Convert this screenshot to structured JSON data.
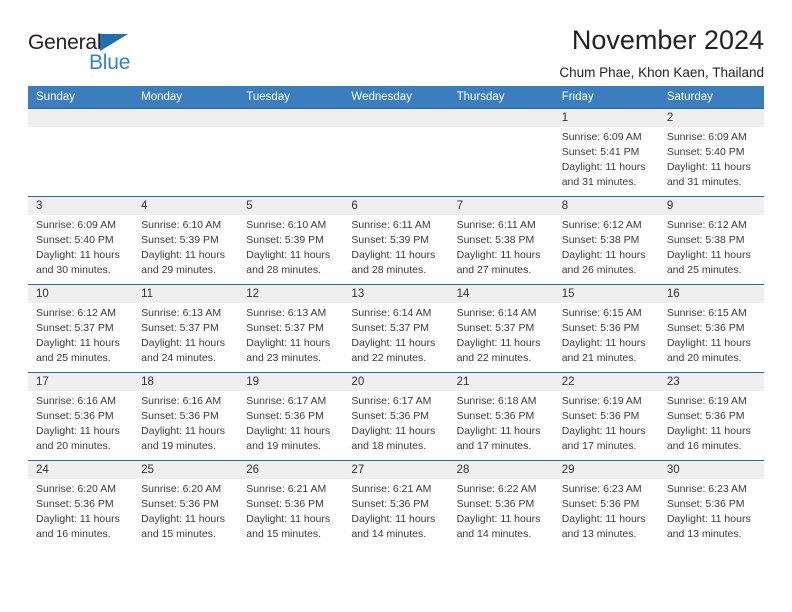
{
  "brand": {
    "name_top": "General",
    "name_bottom": "Blue",
    "triangle_color": "#1f6fb2",
    "blue_text_color": "#2e86d1"
  },
  "header": {
    "title": "November 2024",
    "subtitle": "Chum Phae, Khon Kaen, Thailand"
  },
  "theme": {
    "header_blue": "#3b7ec0",
    "row_divider_blue": "#2b6ca8",
    "daynum_band": "#efefef"
  },
  "weekdays": [
    "Sunday",
    "Monday",
    "Tuesday",
    "Wednesday",
    "Thursday",
    "Friday",
    "Saturday"
  ],
  "weeks": [
    [
      {
        "day": "",
        "sunrise": "",
        "sunset": "",
        "daylight": ""
      },
      {
        "day": "",
        "sunrise": "",
        "sunset": "",
        "daylight": ""
      },
      {
        "day": "",
        "sunrise": "",
        "sunset": "",
        "daylight": ""
      },
      {
        "day": "",
        "sunrise": "",
        "sunset": "",
        "daylight": ""
      },
      {
        "day": "",
        "sunrise": "",
        "sunset": "",
        "daylight": ""
      },
      {
        "day": "1",
        "sunrise": "Sunrise: 6:09 AM",
        "sunset": "Sunset: 5:41 PM",
        "daylight": "Daylight: 11 hours and 31 minutes."
      },
      {
        "day": "2",
        "sunrise": "Sunrise: 6:09 AM",
        "sunset": "Sunset: 5:40 PM",
        "daylight": "Daylight: 11 hours and 31 minutes."
      }
    ],
    [
      {
        "day": "3",
        "sunrise": "Sunrise: 6:09 AM",
        "sunset": "Sunset: 5:40 PM",
        "daylight": "Daylight: 11 hours and 30 minutes."
      },
      {
        "day": "4",
        "sunrise": "Sunrise: 6:10 AM",
        "sunset": "Sunset: 5:39 PM",
        "daylight": "Daylight: 11 hours and 29 minutes."
      },
      {
        "day": "5",
        "sunrise": "Sunrise: 6:10 AM",
        "sunset": "Sunset: 5:39 PM",
        "daylight": "Daylight: 11 hours and 28 minutes."
      },
      {
        "day": "6",
        "sunrise": "Sunrise: 6:11 AM",
        "sunset": "Sunset: 5:39 PM",
        "daylight": "Daylight: 11 hours and 28 minutes."
      },
      {
        "day": "7",
        "sunrise": "Sunrise: 6:11 AM",
        "sunset": "Sunset: 5:38 PM",
        "daylight": "Daylight: 11 hours and 27 minutes."
      },
      {
        "day": "8",
        "sunrise": "Sunrise: 6:12 AM",
        "sunset": "Sunset: 5:38 PM",
        "daylight": "Daylight: 11 hours and 26 minutes."
      },
      {
        "day": "9",
        "sunrise": "Sunrise: 6:12 AM",
        "sunset": "Sunset: 5:38 PM",
        "daylight": "Daylight: 11 hours and 25 minutes."
      }
    ],
    [
      {
        "day": "10",
        "sunrise": "Sunrise: 6:12 AM",
        "sunset": "Sunset: 5:37 PM",
        "daylight": "Daylight: 11 hours and 25 minutes."
      },
      {
        "day": "11",
        "sunrise": "Sunrise: 6:13 AM",
        "sunset": "Sunset: 5:37 PM",
        "daylight": "Daylight: 11 hours and 24 minutes."
      },
      {
        "day": "12",
        "sunrise": "Sunrise: 6:13 AM",
        "sunset": "Sunset: 5:37 PM",
        "daylight": "Daylight: 11 hours and 23 minutes."
      },
      {
        "day": "13",
        "sunrise": "Sunrise: 6:14 AM",
        "sunset": "Sunset: 5:37 PM",
        "daylight": "Daylight: 11 hours and 22 minutes."
      },
      {
        "day": "14",
        "sunrise": "Sunrise: 6:14 AM",
        "sunset": "Sunset: 5:37 PM",
        "daylight": "Daylight: 11 hours and 22 minutes."
      },
      {
        "day": "15",
        "sunrise": "Sunrise: 6:15 AM",
        "sunset": "Sunset: 5:36 PM",
        "daylight": "Daylight: 11 hours and 21 minutes."
      },
      {
        "day": "16",
        "sunrise": "Sunrise: 6:15 AM",
        "sunset": "Sunset: 5:36 PM",
        "daylight": "Daylight: 11 hours and 20 minutes."
      }
    ],
    [
      {
        "day": "17",
        "sunrise": "Sunrise: 6:16 AM",
        "sunset": "Sunset: 5:36 PM",
        "daylight": "Daylight: 11 hours and 20 minutes."
      },
      {
        "day": "18",
        "sunrise": "Sunrise: 6:16 AM",
        "sunset": "Sunset: 5:36 PM",
        "daylight": "Daylight: 11 hours and 19 minutes."
      },
      {
        "day": "19",
        "sunrise": "Sunrise: 6:17 AM",
        "sunset": "Sunset: 5:36 PM",
        "daylight": "Daylight: 11 hours and 19 minutes."
      },
      {
        "day": "20",
        "sunrise": "Sunrise: 6:17 AM",
        "sunset": "Sunset: 5:36 PM",
        "daylight": "Daylight: 11 hours and 18 minutes."
      },
      {
        "day": "21",
        "sunrise": "Sunrise: 6:18 AM",
        "sunset": "Sunset: 5:36 PM",
        "daylight": "Daylight: 11 hours and 17 minutes."
      },
      {
        "day": "22",
        "sunrise": "Sunrise: 6:19 AM",
        "sunset": "Sunset: 5:36 PM",
        "daylight": "Daylight: 11 hours and 17 minutes."
      },
      {
        "day": "23",
        "sunrise": "Sunrise: 6:19 AM",
        "sunset": "Sunset: 5:36 PM",
        "daylight": "Daylight: 11 hours and 16 minutes."
      }
    ],
    [
      {
        "day": "24",
        "sunrise": "Sunrise: 6:20 AM",
        "sunset": "Sunset: 5:36 PM",
        "daylight": "Daylight: 11 hours and 16 minutes."
      },
      {
        "day": "25",
        "sunrise": "Sunrise: 6:20 AM",
        "sunset": "Sunset: 5:36 PM",
        "daylight": "Daylight: 11 hours and 15 minutes."
      },
      {
        "day": "26",
        "sunrise": "Sunrise: 6:21 AM",
        "sunset": "Sunset: 5:36 PM",
        "daylight": "Daylight: 11 hours and 15 minutes."
      },
      {
        "day": "27",
        "sunrise": "Sunrise: 6:21 AM",
        "sunset": "Sunset: 5:36 PM",
        "daylight": "Daylight: 11 hours and 14 minutes."
      },
      {
        "day": "28",
        "sunrise": "Sunrise: 6:22 AM",
        "sunset": "Sunset: 5:36 PM",
        "daylight": "Daylight: 11 hours and 14 minutes."
      },
      {
        "day": "29",
        "sunrise": "Sunrise: 6:23 AM",
        "sunset": "Sunset: 5:36 PM",
        "daylight": "Daylight: 11 hours and 13 minutes."
      },
      {
        "day": "30",
        "sunrise": "Sunrise: 6:23 AM",
        "sunset": "Sunset: 5:36 PM",
        "daylight": "Daylight: 11 hours and 13 minutes."
      }
    ]
  ]
}
